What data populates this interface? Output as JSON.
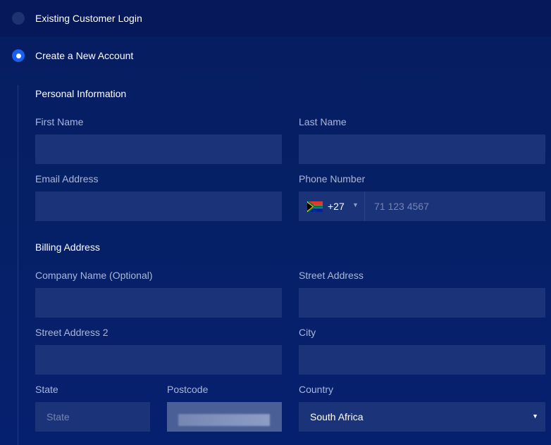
{
  "options": {
    "existing_login": "Existing Customer Login",
    "new_account": "Create a New Account"
  },
  "personal": {
    "title": "Personal Information",
    "first_name_label": "First Name",
    "last_name_label": "Last Name",
    "email_label": "Email Address",
    "phone_label": "Phone Number",
    "phone_dial_code": "+27",
    "phone_placeholder": "71 123 4567"
  },
  "billing": {
    "title": "Billing Address",
    "company_label": "Company Name (Optional)",
    "street_label": "Street Address",
    "street2_label": "Street Address 2",
    "city_label": "City",
    "state_label": "State",
    "state_placeholder": "State",
    "postcode_label": "Postcode",
    "country_label": "Country",
    "country_value": "South Africa"
  },
  "icons": {
    "flag": "south-africa-flag-icon",
    "dropdown": "caret-down-icon"
  },
  "colors": {
    "background": "#061a5c",
    "input_bg": "#1b3378",
    "accent": "#1a5ff0",
    "label": "#aab7d8"
  }
}
